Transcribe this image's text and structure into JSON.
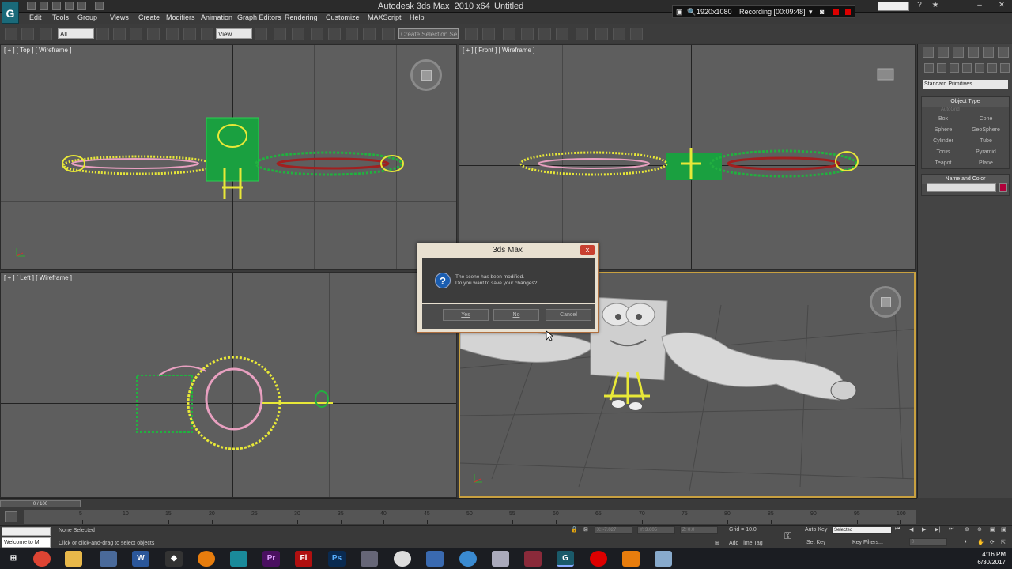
{
  "window": {
    "title": "Autodesk 3ds Max  2010 x64",
    "file": "Untitled",
    "logo": "G"
  },
  "recording": {
    "resolution": "1920x1080",
    "status": "Recording [00:09:48]"
  },
  "menu": [
    "Edit",
    "Tools",
    "Group",
    "Views",
    "Create",
    "Modifiers",
    "Animation",
    "Graph Editors",
    "Rendering",
    "Customize",
    "MAXScript",
    "Help"
  ],
  "toolbar": {
    "selection_filter": "All",
    "ref_coord": "View",
    "named_selection": "Create Selection Se"
  },
  "viewports": {
    "top": "[ + ] [ Top ] [ Wireframe ]",
    "front": "[ + ] [ Front ] [ Wireframe ]",
    "left": "[ + ] [ Left ] [ Wireframe ]"
  },
  "command_panel": {
    "category": "Standard Primitives",
    "object_type_header": "Object Type",
    "autogrid": "AutoGrid",
    "primitives": [
      "Box",
      "Cone",
      "Sphere",
      "GeoSphere",
      "Cylinder",
      "Tube",
      "Torus",
      "Pyramid",
      "Teapot",
      "Plane"
    ],
    "name_color_header": "Name and Color"
  },
  "timeline": {
    "slider": "0 / 100",
    "ticks": [
      "5",
      "10",
      "15",
      "20",
      "25",
      "30",
      "35",
      "40",
      "45",
      "50",
      "55",
      "60",
      "65",
      "70",
      "75",
      "80",
      "85",
      "90",
      "95",
      "100"
    ]
  },
  "status": {
    "welcome": "Welcome to M",
    "selection": "None Selected",
    "prompt": "Click or click-and-drag to select objects",
    "x": "X: -7.027",
    "y": "Y: 3.605",
    "z": "Z: 0.0",
    "grid": "Grid = 10.0",
    "add_time_tag": "Add Time Tag",
    "auto_key": "Auto Key",
    "set_key": "Set Key",
    "key_mode": "Selected",
    "key_filters": "Key Filters...",
    "frame": "0"
  },
  "dialog": {
    "title": "3ds Max",
    "close": "x",
    "line1": "The scene has been modified.",
    "line2": "Do you want to save your changes?",
    "yes": "Yes",
    "no": "No",
    "cancel": "Cancel"
  },
  "clock": {
    "time": "4:16 PM",
    "date": "6/30/2017"
  },
  "taskbar_apps": [
    "windows-start",
    "chrome",
    "file-explorer",
    "network",
    "word",
    "unity",
    "blender",
    "sketchup",
    "premiere",
    "flash",
    "photoshop",
    "settings",
    "itunes",
    "photos",
    "droplet",
    "explorer-window",
    "winrar",
    "3dsmax",
    "recorder",
    "vlc",
    "notepad"
  ],
  "colors": {
    "viewport_bg": "#5e5e5e",
    "active_border": "#c8a040",
    "wire_yellow": "#e8e838",
    "wire_green": "#22b040",
    "wire_pink": "#e8a0c0",
    "close_red": "#c84030",
    "question_blue": "#1a5db0"
  }
}
